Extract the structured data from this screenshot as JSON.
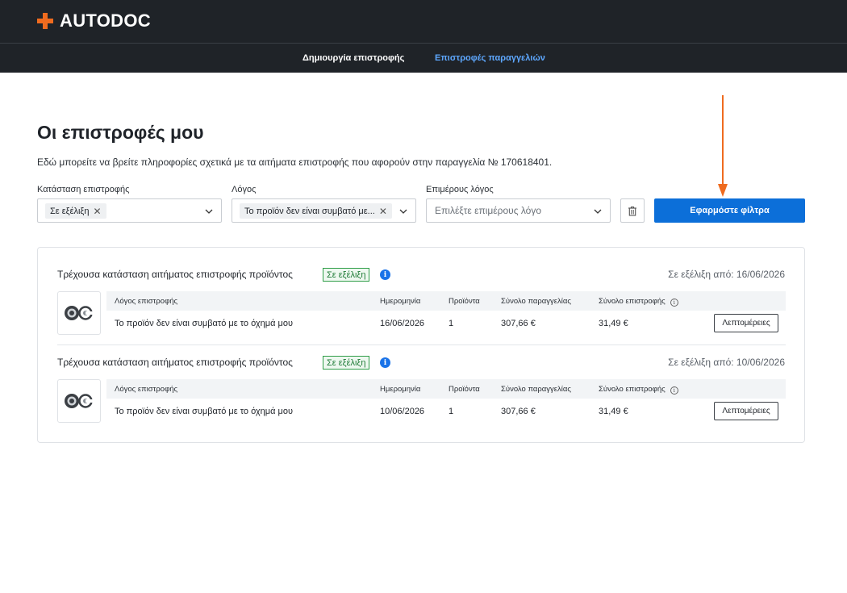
{
  "brand": {
    "name": "AUTODOC",
    "accent": "#ef6b1f"
  },
  "nav": {
    "create_return": "Δημιουργία επιστροφής",
    "order_returns": "Επιστροφές παραγγελιών"
  },
  "page": {
    "title": "Οι επιστροφές μου",
    "description": "Εδώ μπορείτε να βρείτε πληροφορίες σχετικά με τα αιτήματα επιστροφής που αφορούν στην παραγγελία № 170618401."
  },
  "filters": {
    "status": {
      "label": "Κατάσταση επιστροφής",
      "selected": "Σε εξέλιξη"
    },
    "reason": {
      "label": "Λόγος",
      "selected": "Το προϊόν δεν είναι συμβατό με..."
    },
    "sub_reason": {
      "label": "Επιμέρους λόγος",
      "placeholder": "Επιλέξτε επιμέρους λόγο"
    },
    "apply_label": "Εφαρμόστε φίλτρα",
    "apply_color": "#0c6fd9"
  },
  "columns": {
    "reason": "Λόγος επιστροφής",
    "date": "Ημερομηνία",
    "products": "Προϊόντα",
    "order_total": "Σύνολο παραγγελίας",
    "return_total": "Σύνολο επιστροφής"
  },
  "returns": [
    {
      "title": "Τρέχουσα κατάσταση αιτήματος επιστροφής προϊόντος",
      "status": "Σε εξέλιξη",
      "since": "Σε εξέλιξη από: 16/06/2026",
      "reason": "Το προϊόν δεν είναι συμβατό με το όχημά μου",
      "date": "16/06/2026",
      "products": "1",
      "order_total": "307,66 €",
      "return_total": "31,49 €",
      "details_label": "Λεπτομέρειες"
    },
    {
      "title": "Τρέχουσα κατάσταση αιτήματος επιστροφής προϊόντος",
      "status": "Σε εξέλιξη",
      "since": "Σε εξέλιξη από: 10/06/2026",
      "reason": "Το προϊόν δεν είναι συμβατό με το όχημά μου",
      "date": "10/06/2026",
      "products": "1",
      "order_total": "307,66 €",
      "return_total": "31,49 €",
      "details_label": "Λεπτομέρειες"
    }
  ],
  "annotation": {
    "arrow_color": "#ef6b1f"
  }
}
